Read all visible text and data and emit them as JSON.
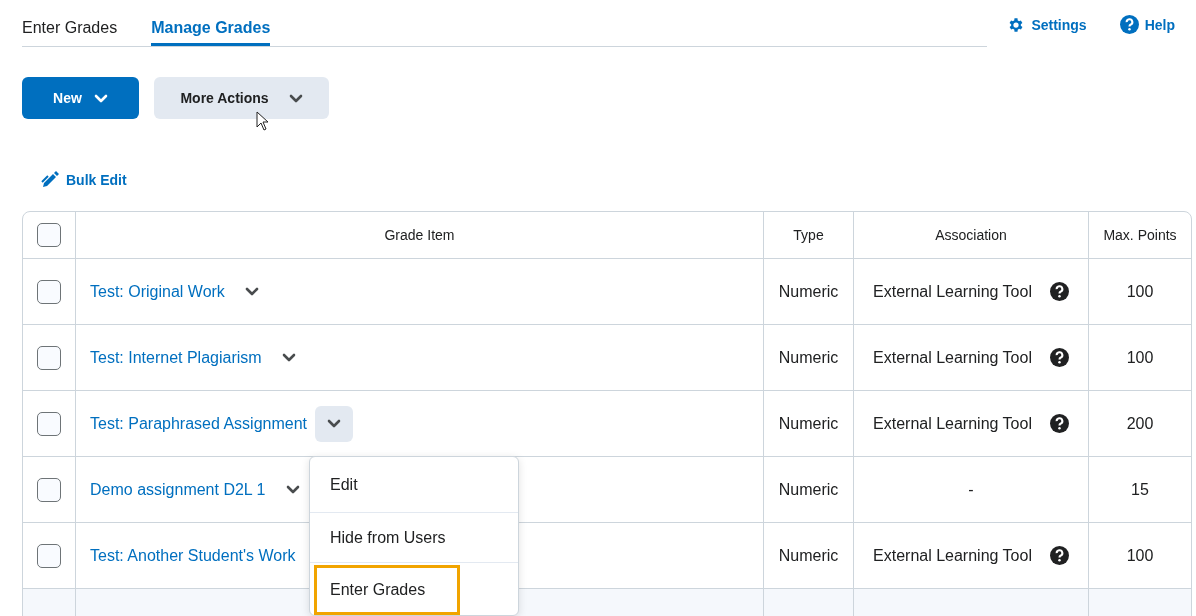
{
  "tabs": [
    {
      "label": "Enter Grades",
      "selected": false
    },
    {
      "label": "Manage Grades",
      "selected": true
    }
  ],
  "header_links": [
    {
      "kind": "settings",
      "label": "Settings"
    },
    {
      "kind": "help",
      "label": "Help"
    }
  ],
  "buttons": [
    {
      "kind": "primary",
      "label": "New"
    },
    {
      "kind": "secondary",
      "label": "More Actions"
    }
  ],
  "bulk_edit": {
    "label": "Bulk Edit"
  },
  "table": {
    "columns": [
      "Grade Item",
      "Type",
      "Association",
      "Max. Points"
    ],
    "header_checkbox": {
      "checked": false
    },
    "rows": [
      {
        "checked": false,
        "name": "Test: Original Work",
        "expanded": false,
        "type": "Numeric",
        "association": "External Learning Tool",
        "help_icon": true,
        "max_points": "100"
      },
      {
        "checked": false,
        "name": "Test: Internet Plagiarism",
        "expanded": false,
        "type": "Numeric",
        "association": "External Learning Tool",
        "help_icon": true,
        "max_points": "100"
      },
      {
        "checked": false,
        "name": "Test: Paraphrased Assignment",
        "expanded": true,
        "type": "Numeric",
        "association": "External Learning Tool",
        "help_icon": true,
        "max_points": "200"
      },
      {
        "checked": false,
        "name": "Demo assignment D2L 1",
        "expanded": false,
        "type": "Numeric",
        "association": "-",
        "help_icon": false,
        "max_points": "15"
      },
      {
        "checked": false,
        "name": "Test: Another Student's Work",
        "type": "Numeric",
        "association": "External Learning Tool",
        "help_icon": true,
        "max_points": "100"
      }
    ]
  },
  "context_menu": {
    "items": [
      {
        "label": "Edit",
        "focused": false
      },
      {
        "label": "Hide from Users",
        "focused": false
      },
      {
        "label": "Enter Grades",
        "focused": true
      }
    ]
  }
}
